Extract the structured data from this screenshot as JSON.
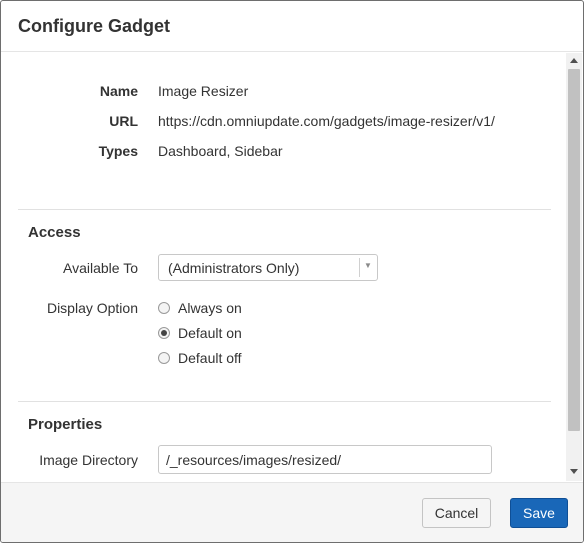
{
  "dialog": {
    "title": "Configure Gadget"
  },
  "info": {
    "name_label": "Name",
    "name_value": "Image Resizer",
    "url_label": "URL",
    "url_value": "https://cdn.omniupdate.com/gadgets/image-resizer/v1/",
    "types_label": "Types",
    "types_value": "Dashboard, Sidebar"
  },
  "access": {
    "title": "Access",
    "available_to_label": "Available To",
    "available_to_value": "(Administrators Only)",
    "display_option_label": "Display Option",
    "options": [
      {
        "label": "Always on",
        "checked": false
      },
      {
        "label": "Default on",
        "checked": true
      },
      {
        "label": "Default off",
        "checked": false
      }
    ]
  },
  "properties": {
    "title": "Properties",
    "image_directory_label": "Image Directory",
    "image_directory_value": "/_resources/images/resized/"
  },
  "footer": {
    "cancel_label": "Cancel",
    "save_label": "Save"
  }
}
